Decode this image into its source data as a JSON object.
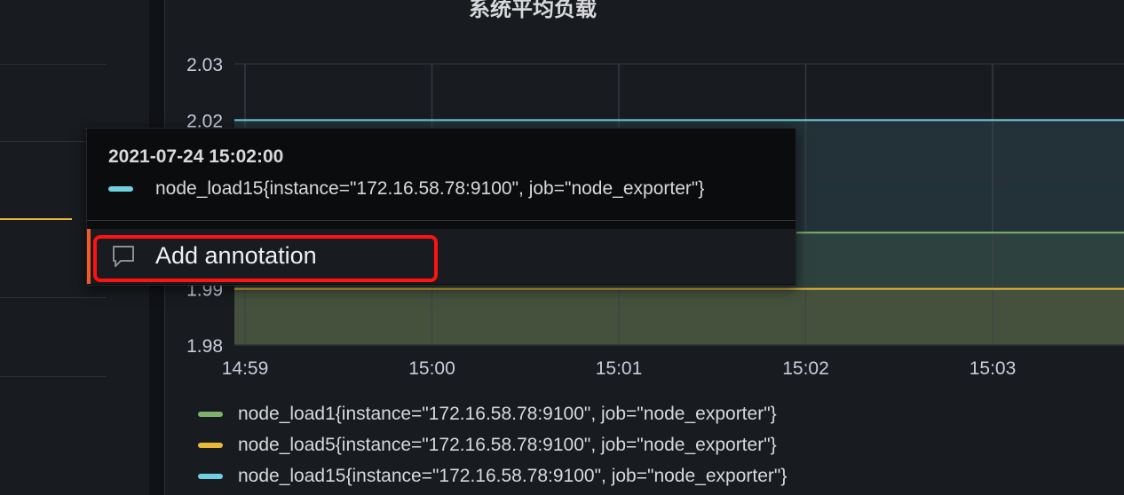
{
  "panel": {
    "title": "系统平均负载"
  },
  "chart_data": {
    "type": "area",
    "title": "系统平均负载",
    "x": [
      "14:59",
      "15:00",
      "15:01",
      "15:02",
      "15:03"
    ],
    "xlim": [
      "14:59",
      "15:03.7"
    ],
    "ylim": [
      1.98,
      2.03
    ],
    "yticks": [
      1.98,
      1.99,
      2.0,
      2.01,
      2.02,
      2.03
    ],
    "ytick_labels": [
      "1.98",
      "1.99",
      "",
      "",
      "2.02",
      "2.03"
    ],
    "grid": true,
    "legend": "bottom",
    "series": [
      {
        "name": "node_load1{instance=\"172.16.58.78:9100\", job=\"node_exporter\"}",
        "color": "#7eb26d",
        "values": [
          2.0,
          2.0,
          2.0,
          2.0,
          2.0
        ]
      },
      {
        "name": "node_load5{instance=\"172.16.58.78:9100\", job=\"node_exporter\"}",
        "color": "#eab839",
        "values": [
          1.99,
          1.99,
          1.99,
          1.99,
          1.99
        ]
      },
      {
        "name": "node_load15{instance=\"172.16.58.78:9100\", job=\"node_exporter\"}",
        "color": "#6ed0e0",
        "values": [
          2.02,
          2.02,
          2.02,
          2.02,
          2.02
        ]
      }
    ]
  },
  "tooltip": {
    "time": "2021-07-24 15:02:00",
    "series_label": "node_load15{instance=\"172.16.58.78:9100\", job=\"node_exporter\"}",
    "series_color": "#6ed0e0",
    "menu": {
      "add_annotation_label": "Add annotation",
      "icon": "comment-icon"
    }
  }
}
